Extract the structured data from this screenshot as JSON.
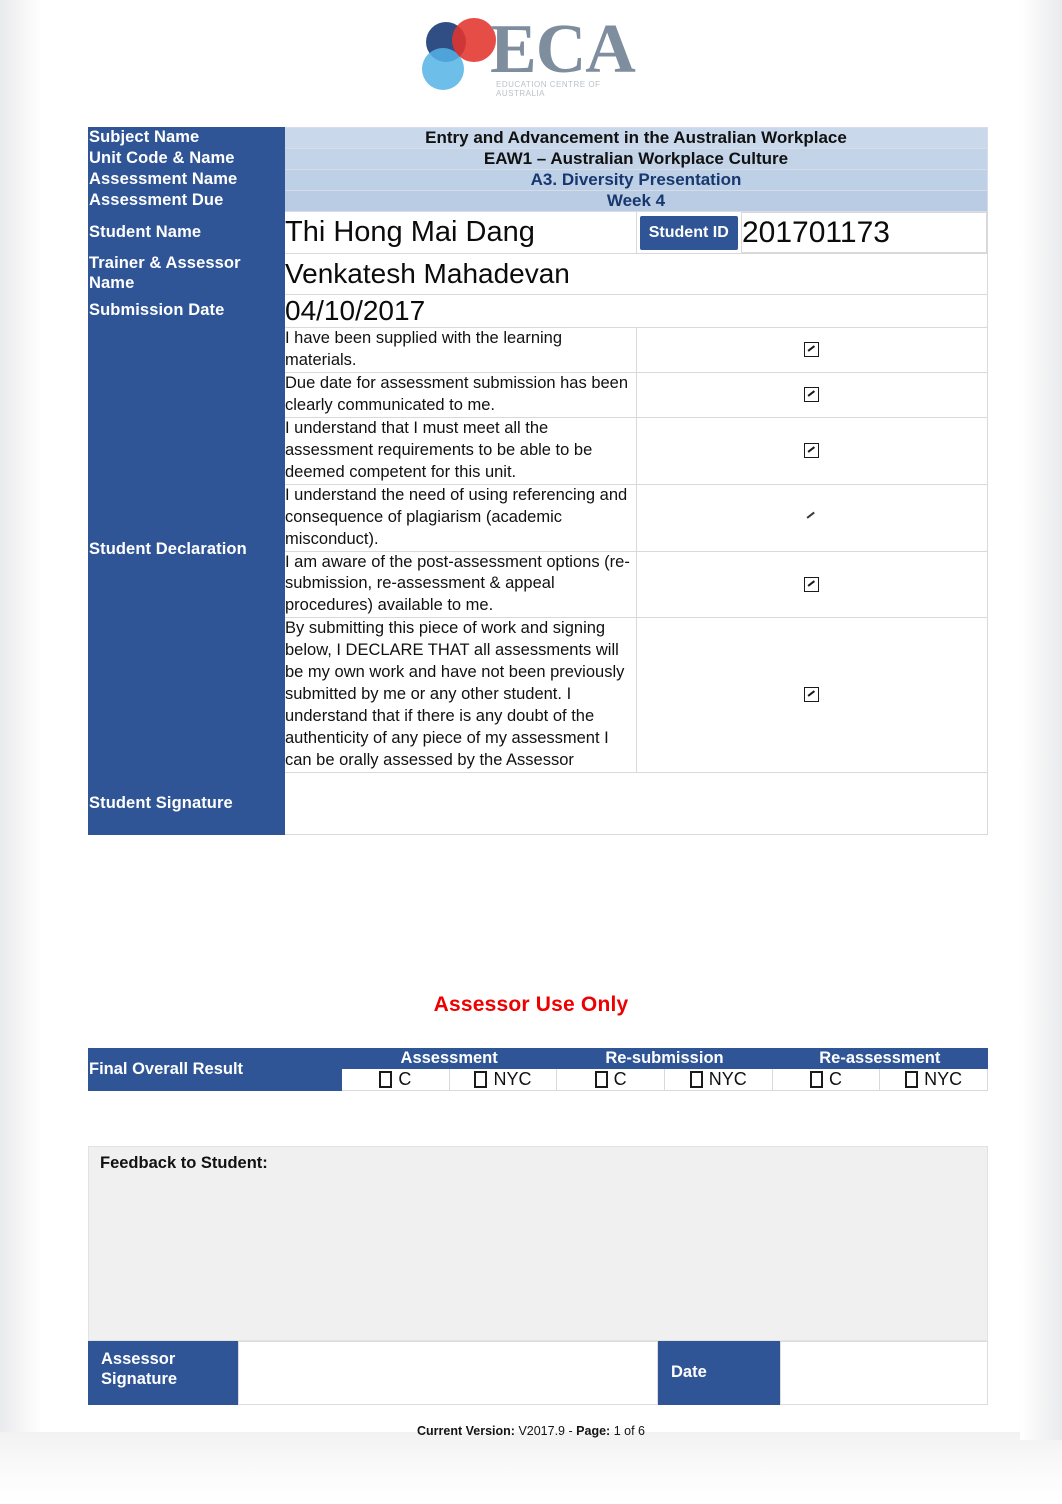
{
  "logo": {
    "text": "ECA",
    "tagline": "EDUCATION CENTRE OF AUSTRALIA"
  },
  "header_table": {
    "rows": [
      {
        "label": "Subject Name",
        "value": "Entry and Advancement in the Australian Workplace"
      },
      {
        "label": "Unit Code & Name",
        "value": "EAW1 – Australian Workplace Culture"
      },
      {
        "label": "Assessment Name",
        "value": "A3. Diversity Presentation"
      },
      {
        "label": "Assessment Due",
        "value": "Week 4"
      }
    ]
  },
  "student": {
    "name_label": "Student Name",
    "name_value": "Thi Hong Mai Dang",
    "id_label": "Student ID",
    "id_value": "201701173",
    "trainer_label": "Trainer & Assessor Name",
    "trainer_value": "Venkatesh Mahadevan",
    "submission_label": "Submission Date",
    "submission_value": "04/10/2017"
  },
  "declaration": {
    "label": "Student Declaration",
    "signature_label": "Student Signature",
    "signature_value": "",
    "items": [
      {
        "text": "I have been supplied with the learning materials.",
        "checked": true,
        "style": "box"
      },
      {
        "text": "Due date for assessment submission has been clearly communicated to me.",
        "checked": true,
        "style": "box"
      },
      {
        "text": "I understand that I must meet all the assessment requirements to be able to be deemed competent for this unit.",
        "checked": true,
        "style": "box"
      },
      {
        "text": "I understand the need of using referencing and consequence of plagiarism (academic misconduct).",
        "checked": true,
        "style": "tick-only"
      },
      {
        "text": "I am aware of the post-assessment options (re-submission, re-assessment & appeal procedures) available to me.",
        "checked": true,
        "style": "box"
      },
      {
        "text": "By submitting this piece of work and signing below, I DECLARE THAT all assessments will be my own work and have not been previously submitted by me or any other student. I understand that if there is any doubt of the authenticity of any piece of my assessment I can be orally assessed by the Assessor",
        "checked": true,
        "style": "box"
      }
    ]
  },
  "assessor": {
    "title": "Assessor Use Only",
    "result_label": "Final Overall Result",
    "columns": [
      "Assessment",
      "Re-submission",
      "Re-assessment"
    ],
    "options": [
      "C",
      "NYC"
    ],
    "feedback_label": "Feedback to Student:",
    "feedback_value": "",
    "signature_label": "Assessor Signature",
    "signature_value": "",
    "date_label": "Date",
    "date_value": ""
  },
  "footer": {
    "version_label": "Current Version:",
    "version_value": "V2017.9",
    "separator": "-",
    "page_label": "Page:",
    "page_value": "1 of 6"
  },
  "colors": {
    "header_blue": "#2f5597",
    "light_blue": "#c5d6e8",
    "navy_text": "#17376e",
    "accent_red": "#ee0000"
  }
}
